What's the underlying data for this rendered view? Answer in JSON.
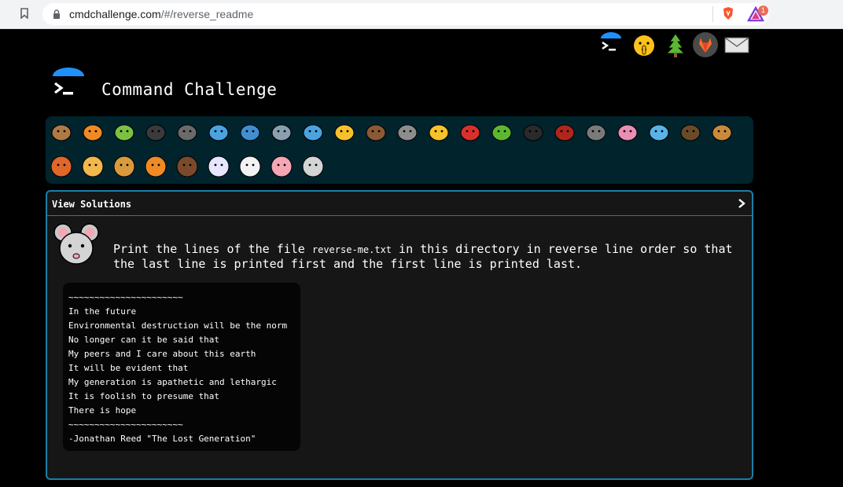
{
  "browser": {
    "url_host": "cmdchallenge.com",
    "url_path": "/#/reverse_readme",
    "extension_badge": "1"
  },
  "header": {
    "title": "Command Challenge"
  },
  "top_icons": [
    "terminal-icon",
    "shushing-face-icon",
    "tree-icon",
    "gitlab-icon",
    "envelope-icon"
  ],
  "animals": [
    "snail",
    "butterfly",
    "caterpillar",
    "ant",
    "spider-web",
    "whale",
    "dolphin",
    "shark",
    "fish",
    "tropical-fish",
    "hedgehog",
    "wolf",
    "bee",
    "ladybug",
    "lizard",
    "spider",
    "scorpion",
    "fly",
    "worm",
    "microbe",
    "monkey",
    "dog",
    "fox",
    "cat",
    "lion",
    "tiger",
    "horse",
    "unicorn",
    "cow",
    "pig",
    "mouse"
  ],
  "panel": {
    "header_label": "View Solutions",
    "prompt_before": "Print the lines of the file ",
    "prompt_file": "reverse-me.txt",
    "prompt_after": " in this directory in reverse line order so that the last line is printed first and the first line is printed last.",
    "code_lines": [
      "~~~~~~~~~~~~~~~~~~~~~~",
      "In the future",
      "Environmental destruction will be the norm",
      "No longer can it be said that",
      "My peers and I care about this earth",
      "It will be evident that",
      "My generation is apathetic and lethargic",
      "It is foolish to presume that",
      "There is hope",
      "~~~~~~~~~~~~~~~~~~~~~~",
      "-Jonathan Reed \"The Lost Generation\""
    ]
  },
  "colors": {
    "accent": "#1b7fa6",
    "strip_bg": "#00232c",
    "logo_blue": "#1e90ff"
  }
}
